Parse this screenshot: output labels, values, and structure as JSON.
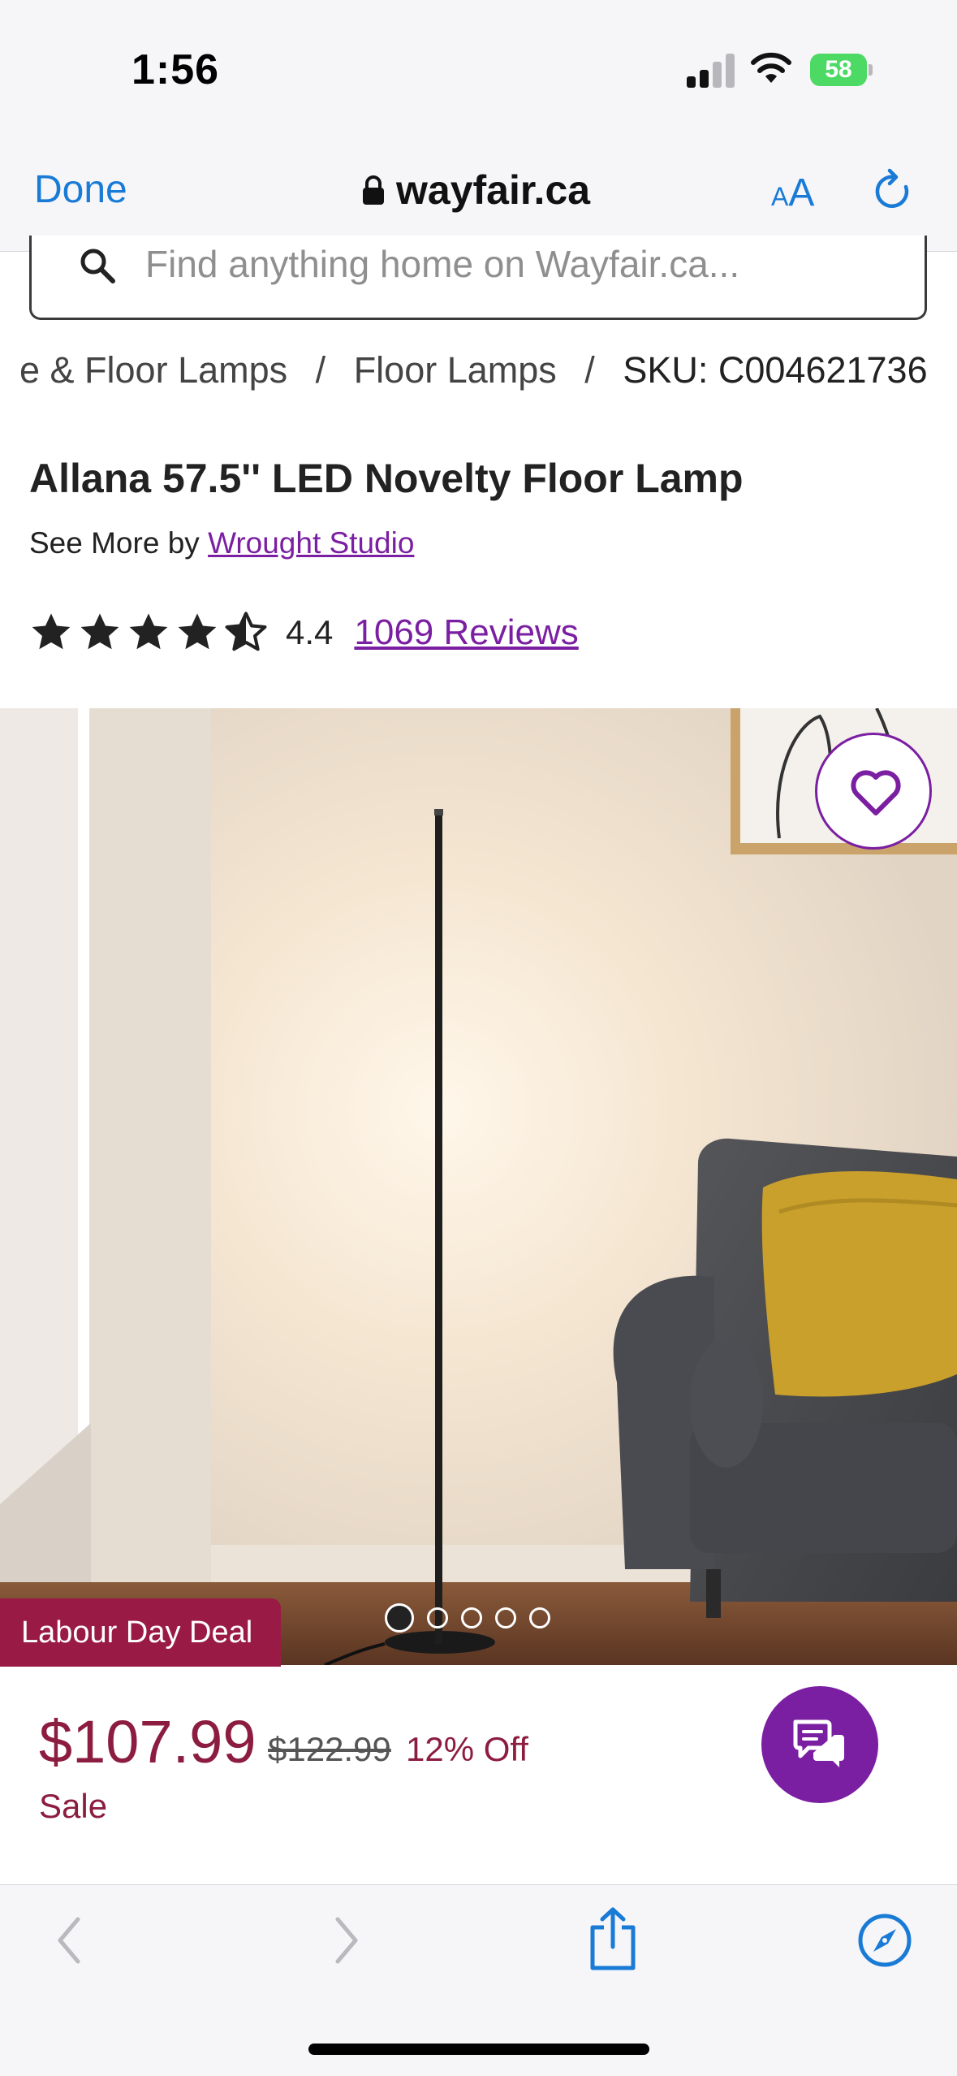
{
  "status_bar": {
    "time": "1:56",
    "battery": "58",
    "icons": [
      "cellular-signal-icon",
      "wifi-icon",
      "battery-charging-icon"
    ]
  },
  "browser": {
    "done_label": "Done",
    "url": "wayfair.ca",
    "text_size_small": "A",
    "text_size_large": "A",
    "icons": [
      "lock-icon",
      "reload-icon"
    ]
  },
  "search": {
    "placeholder": "Find anything home on Wayfair.ca...",
    "value": ""
  },
  "breadcrumb": {
    "items": [
      "e & Floor Lamps",
      "Floor Lamps"
    ],
    "separator": "/",
    "sku": "SKU: C004621736"
  },
  "product": {
    "title": "Allana 57.5'' LED Novelty Floor Lamp",
    "see_more_prefix": "See More by",
    "brand": "Wrought Studio",
    "rating_value": "4.4",
    "rating_stars": 4.5,
    "reviews": "1069 Reviews",
    "deal_badge": "Labour Day Deal",
    "image_count": 5,
    "active_image": 1,
    "price": "$107.99",
    "old_price": "$122.99",
    "discount": "12% Off",
    "sale_label": "Sale"
  },
  "colors": {
    "accent_purple": "#7b1fa2",
    "price_red": "#8c1d40",
    "deal_badge": "#9a1a46",
    "ios_blue": "#1a7bd6",
    "battery_green": "#4cd964"
  },
  "toolbar": {
    "icons": [
      "back-icon",
      "forward-icon",
      "share-icon",
      "compass-icon"
    ]
  }
}
